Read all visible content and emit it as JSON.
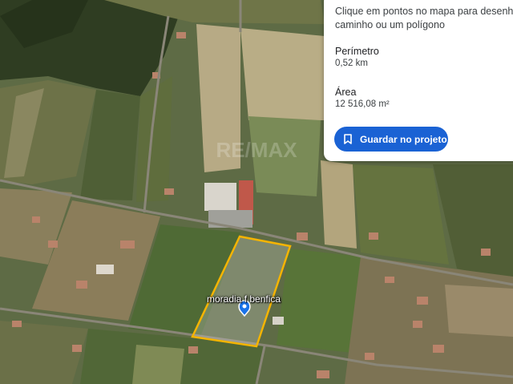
{
  "measure_panel": {
    "hint": "Clique em pontos no mapa para desenhar um caminho ou um polígono",
    "hint_line1": "Clique em pontos no mapa para desenhar um",
    "hint_line2": "caminho ou um polígono",
    "perimeter_label": "Perímetro",
    "perimeter_value": "0,52 km",
    "area_label": "Área",
    "area_value": "12 516,08 m²",
    "save_button": "Guardar no projeto",
    "save_icon": "bookmark-icon",
    "accent_color": "#1a62d4"
  },
  "map": {
    "polygon_label": "moradia f benfica",
    "polygon_color": "#f5b400",
    "watermark": "RE/MAX",
    "pin_icon": "location-pin-icon",
    "pin_color": "#1a73e8"
  }
}
